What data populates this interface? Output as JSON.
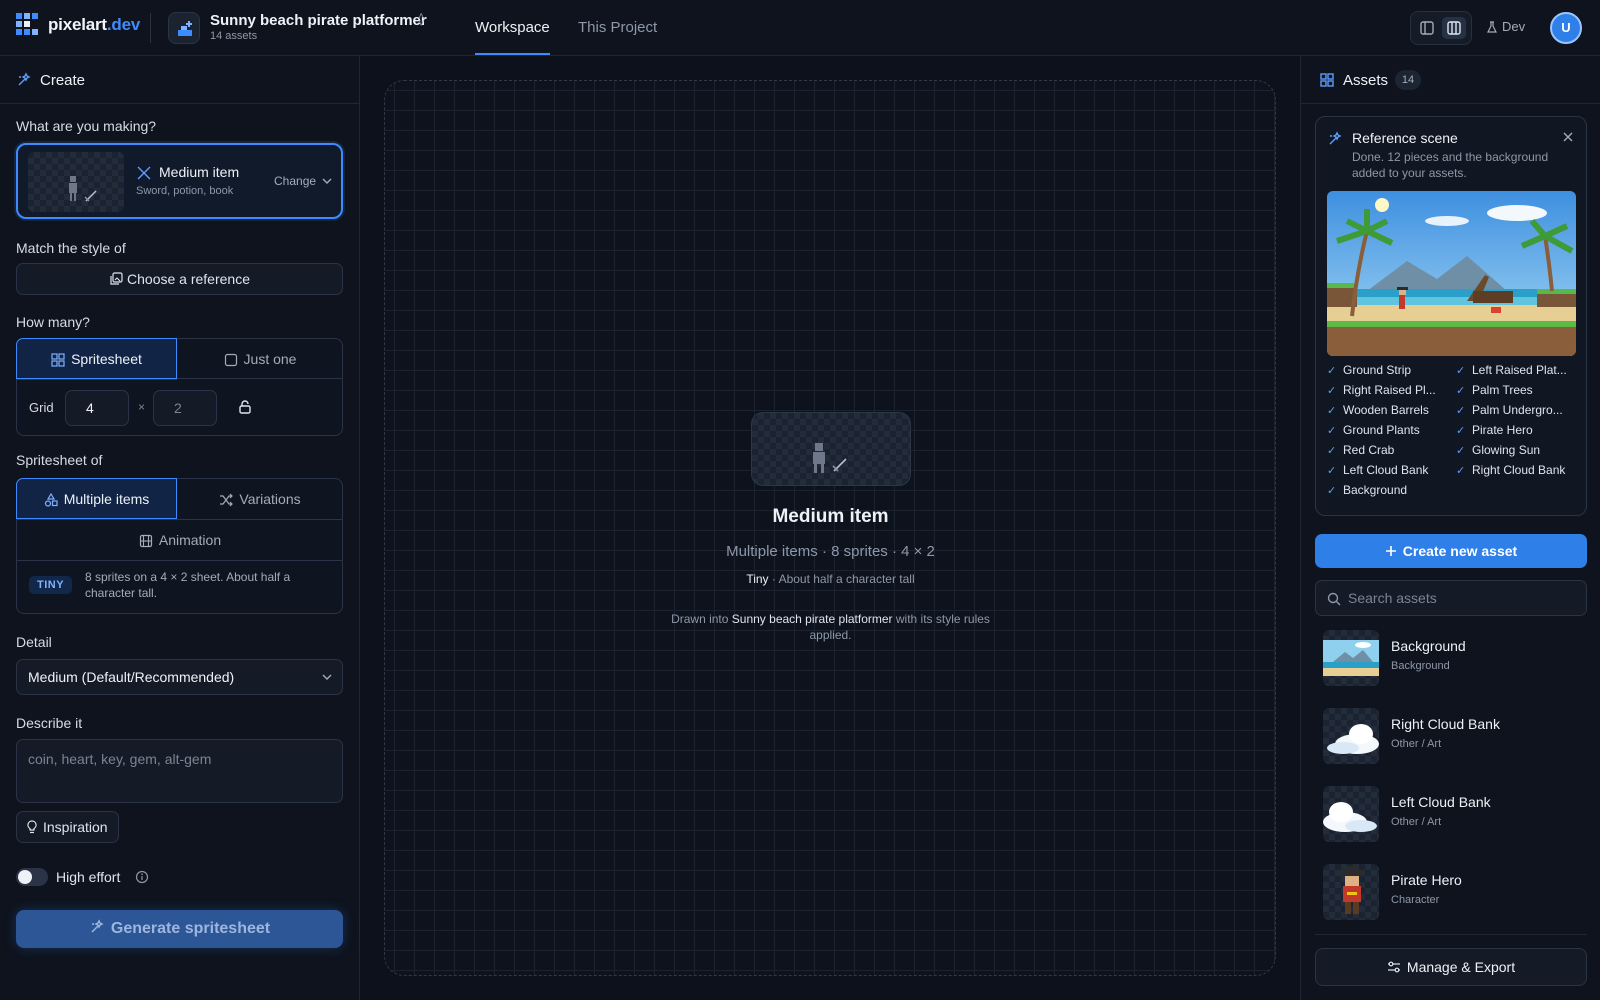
{
  "app": {
    "brand_main": "pixelart",
    "brand_suffix": ".dev"
  },
  "project": {
    "title": "Sunny beach pirate platformer",
    "asset_count_label": "14 assets"
  },
  "nav": {
    "tabs": [
      {
        "label": "Workspace",
        "active": true
      },
      {
        "label": "This Project",
        "active": false
      }
    ]
  },
  "toolbar": {
    "dev_label": "Dev",
    "avatar_initial": "U"
  },
  "create_panel": {
    "title": "Create",
    "making_label": "What are you making?",
    "item": {
      "name": "Medium item",
      "description": "Sword, potion, book",
      "change_label": "Change"
    },
    "style_label": "Match the style of",
    "reference_button": "Choose a reference",
    "how_many_label": "How many?",
    "count_options": [
      {
        "label": "Spritesheet",
        "active": true
      },
      {
        "label": "Just one",
        "active": false
      }
    ],
    "grid": {
      "label": "Grid",
      "cols": "4",
      "rows": "2",
      "times": "×"
    },
    "sheet_of_label": "Spritesheet of",
    "sheet_options": [
      {
        "label": "Multiple items",
        "active": true
      },
      {
        "label": "Variations",
        "active": false
      },
      {
        "label": "Animation",
        "active": false
      }
    ],
    "size_badge": "TINY",
    "size_text": "8 sprites on a 4 × 2 sheet. About half a character tall.",
    "detail_label": "Detail",
    "detail_value": "Medium (Default/Recommended)",
    "describe_label": "Describe it",
    "describe_placeholder": "coin, heart, key, gem, alt-gem",
    "inspiration_label": "Inspiration",
    "high_effort_label": "High effort",
    "high_effort_on": false,
    "generate_label": "Generate spritesheet"
  },
  "canvas": {
    "title": "Medium item",
    "subtitle": "Multiple items · 8 sprites · 4 × 2",
    "size_name": "Tiny",
    "size_desc": " · About half a character tall",
    "note_prefix": "Drawn into ",
    "note_project": "Sunny beach pirate platformer",
    "note_suffix": " with its style rules applied."
  },
  "assets_panel": {
    "title": "Assets",
    "count": "14",
    "reference_card": {
      "title": "Reference scene",
      "description": "Done. 12 pieces and the background added to your assets.",
      "pieces": [
        "Ground Strip",
        "Left Raised Plat...",
        "Right Raised Pl...",
        "Palm Trees",
        "Wooden Barrels",
        "Palm Undergro...",
        "Ground Plants",
        "Pirate Hero",
        "Red Crab",
        "Glowing Sun",
        "Left Cloud Bank",
        "Right Cloud Bank",
        "Background"
      ]
    },
    "create_button": "Create new asset",
    "search_placeholder": "Search assets",
    "assets": [
      {
        "name": "Background",
        "type": "Background"
      },
      {
        "name": "Right Cloud Bank",
        "type": "Other / Art"
      },
      {
        "name": "Left Cloud Bank",
        "type": "Other / Art"
      },
      {
        "name": "Pirate Hero",
        "type": "Character"
      }
    ],
    "manage_button": "Manage & Export"
  },
  "colors": {
    "accent": "#3d8bff",
    "background": "#0c111b",
    "panel": "#0e131d"
  }
}
